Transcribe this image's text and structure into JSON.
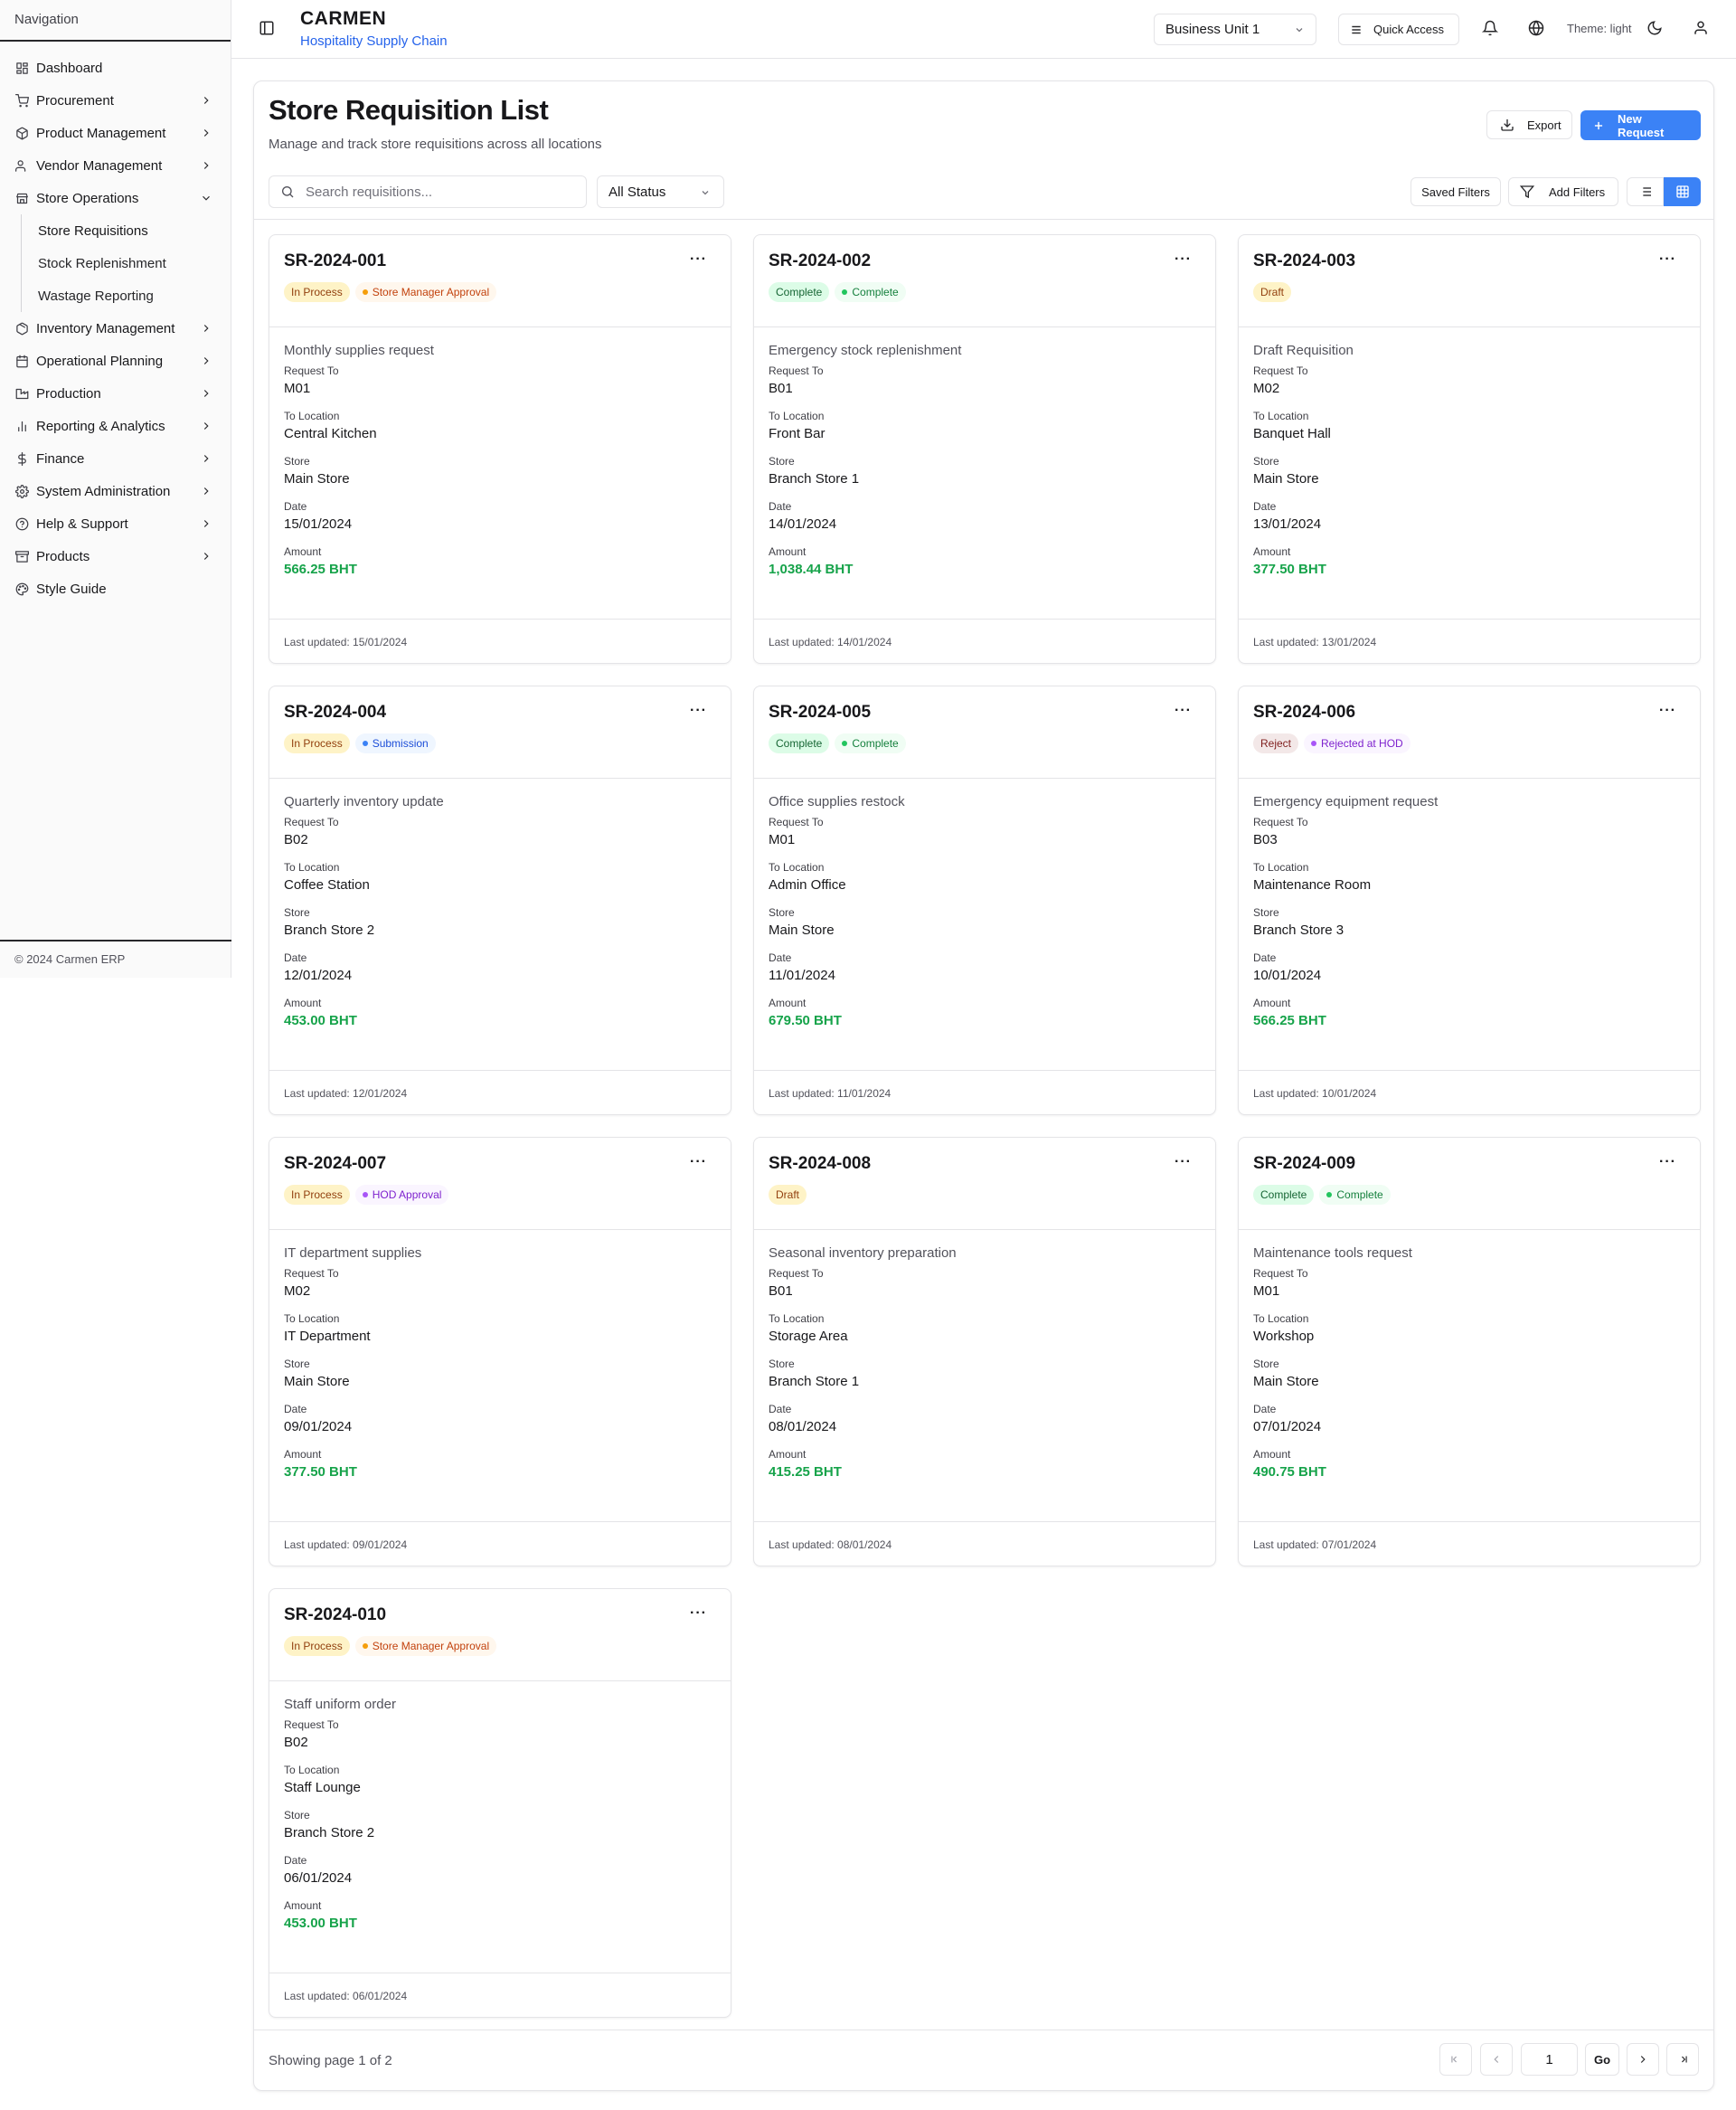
{
  "sidebar": {
    "header": "Navigation",
    "items": [
      {
        "label": "Dashboard",
        "icon": "dashboard-icon",
        "chevron": false
      },
      {
        "label": "Procurement",
        "icon": "cart-icon",
        "chevron": true
      },
      {
        "label": "Product Management",
        "icon": "box-icon",
        "chevron": true
      },
      {
        "label": "Vendor Management",
        "icon": "users-icon",
        "chevron": true
      },
      {
        "label": "Store Operations",
        "icon": "store-icon",
        "chevron": true,
        "expanded": true
      },
      {
        "label": "Inventory Management",
        "icon": "package-icon",
        "chevron": true
      },
      {
        "label": "Operational Planning",
        "icon": "calendar-icon",
        "chevron": true
      },
      {
        "label": "Production",
        "icon": "factory-icon",
        "chevron": true
      },
      {
        "label": "Reporting & Analytics",
        "icon": "bar-chart-icon",
        "chevron": true
      },
      {
        "label": "Finance",
        "icon": "dollar-icon",
        "chevron": true
      },
      {
        "label": "System Administration",
        "icon": "gear-icon",
        "chevron": true
      },
      {
        "label": "Help & Support",
        "icon": "help-icon",
        "chevron": true
      },
      {
        "label": "Products",
        "icon": "product-box-icon",
        "chevron": true
      },
      {
        "label": "Style Guide",
        "icon": "palette-icon",
        "chevron": false
      }
    ],
    "subitems": [
      "Store Requisitions",
      "Stock Replenishment",
      "Wastage Reporting"
    ],
    "footer": "© 2024 Carmen ERP"
  },
  "topbar": {
    "title": "CARMEN",
    "subtitle": "Hospitality Supply Chain",
    "business_unit": "Business Unit 1",
    "quick_access": "Quick Access",
    "theme_label": "Theme: light"
  },
  "page": {
    "title": "Store Requisition List",
    "subtitle": "Manage and track store requisitions across all locations",
    "export_label": "Export",
    "new_request_label": "New Request",
    "search_placeholder": "Search requisitions...",
    "status_filter": "All Status",
    "saved_filters_label": "Saved Filters",
    "add_filters_label": "Add Filters"
  },
  "labels": {
    "request_to": "Request To",
    "to_location": "To Location",
    "store": "Store",
    "date": "Date",
    "amount": "Amount"
  },
  "colors": {
    "primary": "#3b82f6",
    "amount": "#16a34a",
    "in_process_bg": "#fef3c7",
    "complete_bg": "#dcfce7",
    "draft_bg": "#fef3c7",
    "reject_bg": "#fde2e2"
  },
  "cards": [
    {
      "id": "SR-2024-001",
      "status": "In Process",
      "status_type": "in-process",
      "stage": "Store Manager Approval",
      "stage_type": "orange",
      "description": "Monthly supplies request",
      "request_to": "M01",
      "to_location": "Central Kitchen",
      "store": "Main Store",
      "date": "15/01/2024",
      "amount": "566.25 BHT",
      "updated": "Last updated: 15/01/2024"
    },
    {
      "id": "SR-2024-002",
      "status": "Complete",
      "status_type": "complete",
      "stage": "Complete",
      "stage_type": "green",
      "description": "Emergency stock replenishment",
      "request_to": "B01",
      "to_location": "Front Bar",
      "store": "Branch Store 1",
      "date": "14/01/2024",
      "amount": "1,038.44 BHT",
      "updated": "Last updated: 14/01/2024"
    },
    {
      "id": "SR-2024-003",
      "status": "Draft",
      "status_type": "draft",
      "stage": "",
      "stage_type": "",
      "description": "Draft Requisition",
      "request_to": "M02",
      "to_location": "Banquet Hall",
      "store": "Main Store",
      "date": "13/01/2024",
      "amount": "377.50 BHT",
      "updated": "Last updated: 13/01/2024"
    },
    {
      "id": "SR-2024-004",
      "status": "In Process",
      "status_type": "in-process",
      "stage": "Submission",
      "stage_type": "blue",
      "description": "Quarterly inventory update",
      "request_to": "B02",
      "to_location": "Coffee Station",
      "store": "Branch Store 2",
      "date": "12/01/2024",
      "amount": "453.00 BHT",
      "updated": "Last updated: 12/01/2024"
    },
    {
      "id": "SR-2024-005",
      "status": "Complete",
      "status_type": "complete",
      "stage": "Complete",
      "stage_type": "green",
      "description": "Office supplies restock",
      "request_to": "M01",
      "to_location": "Admin Office",
      "store": "Main Store",
      "date": "11/01/2024",
      "amount": "679.50 BHT",
      "updated": "Last updated: 11/01/2024"
    },
    {
      "id": "SR-2024-006",
      "status": "Reject",
      "status_type": "reject",
      "stage": "Rejected at HOD",
      "stage_type": "purple",
      "description": "Emergency equipment request",
      "request_to": "B03",
      "to_location": "Maintenance Room",
      "store": "Branch Store 3",
      "date": "10/01/2024",
      "amount": "566.25 BHT",
      "updated": "Last updated: 10/01/2024"
    },
    {
      "id": "SR-2024-007",
      "status": "In Process",
      "status_type": "in-process",
      "stage": "HOD Approval",
      "stage_type": "purple",
      "description": "IT department supplies",
      "request_to": "M02",
      "to_location": "IT Department",
      "store": "Main Store",
      "date": "09/01/2024",
      "amount": "377.50 BHT",
      "updated": "Last updated: 09/01/2024"
    },
    {
      "id": "SR-2024-008",
      "status": "Draft",
      "status_type": "draft",
      "stage": "",
      "stage_type": "",
      "description": "Seasonal inventory preparation",
      "request_to": "B01",
      "to_location": "Storage Area",
      "store": "Branch Store 1",
      "date": "08/01/2024",
      "amount": "415.25 BHT",
      "updated": "Last updated: 08/01/2024"
    },
    {
      "id": "SR-2024-009",
      "status": "Complete",
      "status_type": "complete",
      "stage": "Complete",
      "stage_type": "green",
      "description": "Maintenance tools request",
      "request_to": "M01",
      "to_location": "Workshop",
      "store": "Main Store",
      "date": "07/01/2024",
      "amount": "490.75 BHT",
      "updated": "Last updated: 07/01/2024"
    },
    {
      "id": "SR-2024-010",
      "status": "In Process",
      "status_type": "in-process",
      "stage": "Store Manager Approval",
      "stage_type": "orange",
      "description": "Staff uniform order",
      "request_to": "B02",
      "to_location": "Staff Lounge",
      "store": "Branch Store 2",
      "date": "06/01/2024",
      "amount": "453.00 BHT",
      "updated": "Last updated: 06/01/2024"
    }
  ],
  "pagination": {
    "text": "Showing page 1 of 2",
    "current_page": "1",
    "go_label": "Go"
  }
}
